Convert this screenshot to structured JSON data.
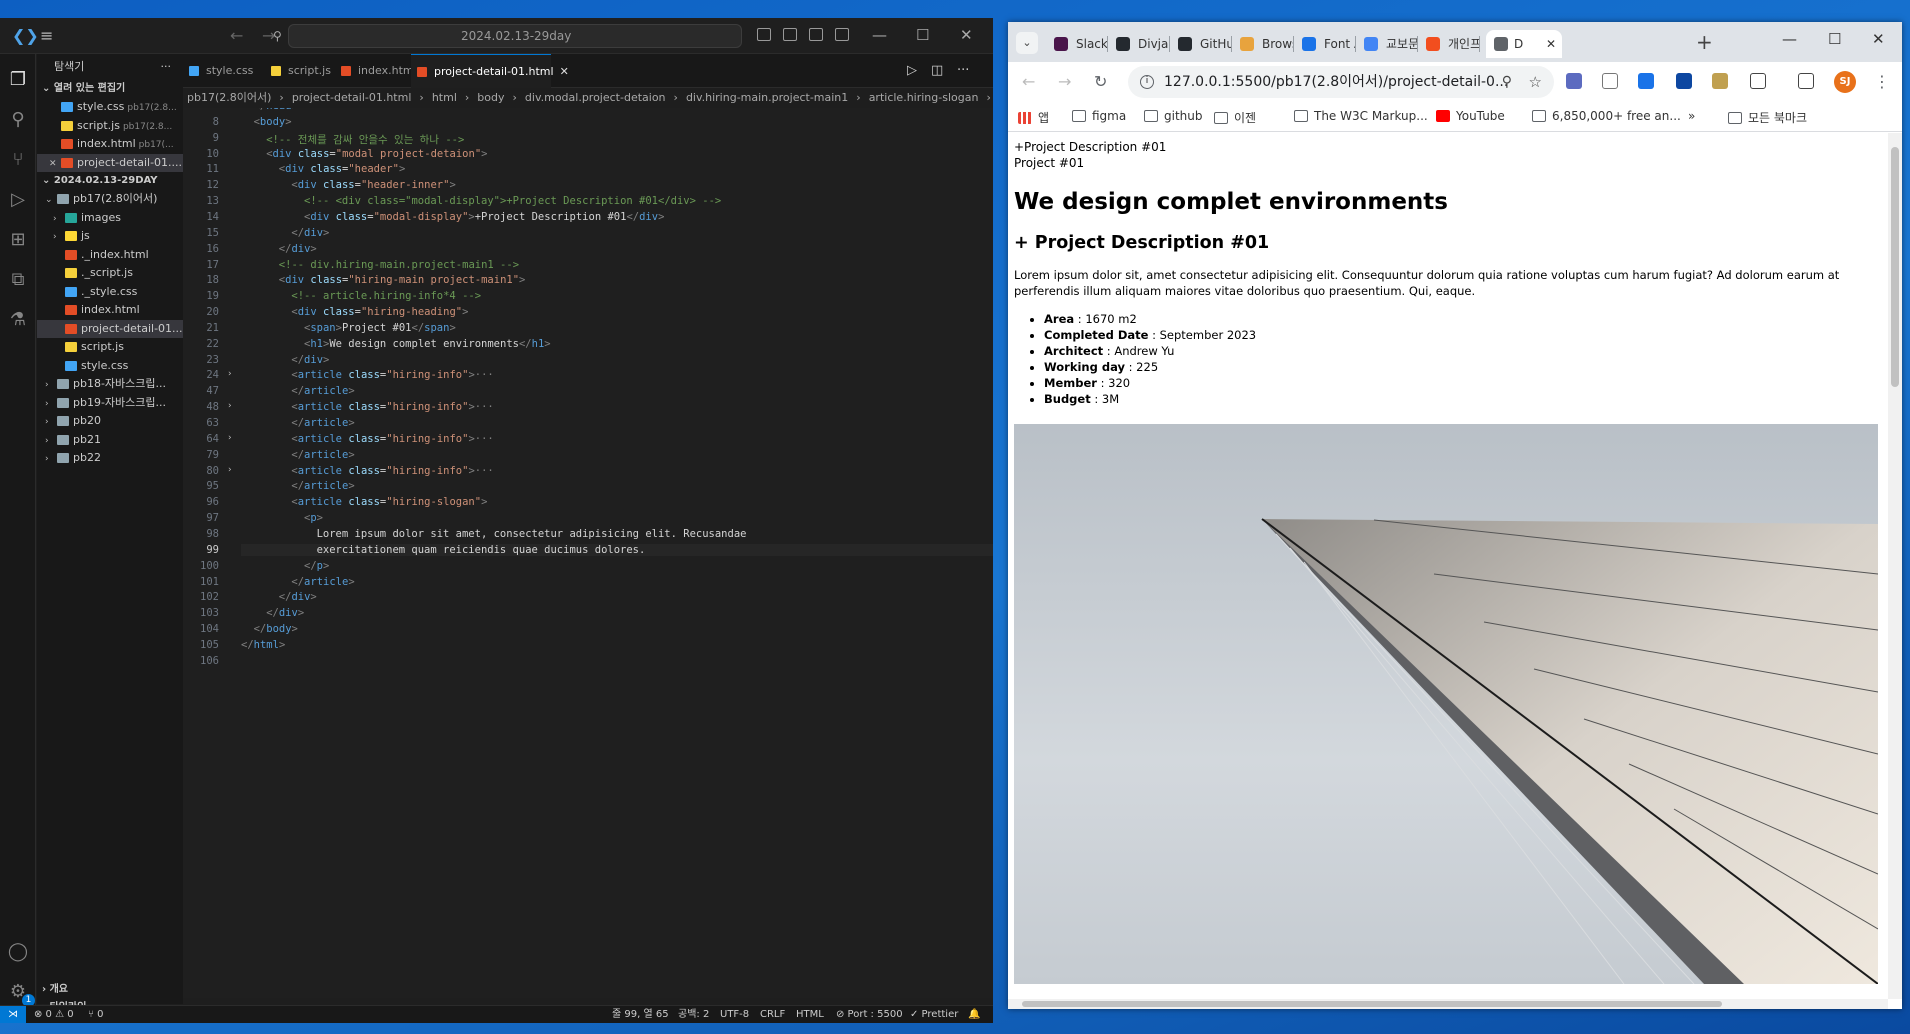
{
  "vscode": {
    "search_text": "2024.02.13-29day",
    "sidebar": {
      "title": "탐색기",
      "more": "···",
      "open_editors_label": "열려 있는 편집기",
      "open_editors": [
        {
          "name": "style.css",
          "desc": "pb17(2.8..."
        },
        {
          "name": "script.js",
          "desc": "pb17(2.8..."
        },
        {
          "name": "index.html",
          "desc": "pb17(..."
        },
        {
          "name": "project-detail-01....",
          "desc": ""
        }
      ],
      "workspace_label": "2024.02.13-29DAY",
      "tree": [
        {
          "name": "pb17(2.8이어서)",
          "kind": "folder-open",
          "depth": 1
        },
        {
          "name": "images",
          "kind": "folder-img",
          "depth": 2
        },
        {
          "name": "js",
          "kind": "folder-js",
          "depth": 2
        },
        {
          "name": "._index.html",
          "kind": "html",
          "depth": 2
        },
        {
          "name": "._script.js",
          "kind": "js",
          "depth": 2
        },
        {
          "name": "._style.css",
          "kind": "css",
          "depth": 2
        },
        {
          "name": "index.html",
          "kind": "html",
          "depth": 2
        },
        {
          "name": "project-detail-01....",
          "kind": "html",
          "depth": 2
        },
        {
          "name": "script.js",
          "kind": "js",
          "depth": 2
        },
        {
          "name": "style.css",
          "kind": "css",
          "depth": 2
        },
        {
          "name": "pb18-자바스크립...",
          "kind": "folder",
          "depth": 1
        },
        {
          "name": "pb19-자바스크립...",
          "kind": "folder",
          "depth": 1
        },
        {
          "name": "pb20",
          "kind": "folder",
          "depth": 1
        },
        {
          "name": "pb21",
          "kind": "folder",
          "depth": 1
        },
        {
          "name": "pb22",
          "kind": "folder",
          "depth": 1
        }
      ],
      "outline_label": "개요",
      "timeline_label": "타임라인"
    },
    "tabs": [
      {
        "label": "style.css",
        "kind": "css"
      },
      {
        "label": "script.js",
        "kind": "js"
      },
      {
        "label": "index.html",
        "kind": "html"
      },
      {
        "label": "project-detail-01.html",
        "kind": "html",
        "active": true
      }
    ],
    "breadcrumbs": [
      "pb17(2.8이어서)",
      "›",
      "project-detail-01.html",
      "›",
      "html",
      "›",
      "body",
      "›",
      "div.modal.project-detaion",
      "›",
      "div.hiring-main.project-main1",
      "›",
      "article.hiring-slogan",
      "›",
      "p"
    ],
    "code_lines": [
      {
        "n": "",
        "html": "<span class=\"br\">&lt;/</span><span class=\"tg\">head</span><span class=\"br\">&gt;</span>",
        "indent": 1
      },
      {
        "n": "8",
        "html": "<span class=\"br\">&lt;</span><span class=\"tg\">body</span><span class=\"br\">&gt;</span>",
        "indent": 1
      },
      {
        "n": "9",
        "html": "<span class=\"cm\">&lt;!-- 전체를 감싸 안을수 있는 하나 --&gt;</span>",
        "indent": 2
      },
      {
        "n": "10",
        "html": "<span class=\"br\">&lt;</span><span class=\"tg\">div</span> <span class=\"at\">class</span>=<span class=\"sv\">\"modal project-detaion\"</span><span class=\"br\">&gt;</span>",
        "indent": 2
      },
      {
        "n": "11",
        "html": "<span class=\"br\">&lt;</span><span class=\"tg\">div</span> <span class=\"at\">class</span>=<span class=\"sv\">\"header\"</span><span class=\"br\">&gt;</span>",
        "indent": 3
      },
      {
        "n": "12",
        "html": "<span class=\"br\">&lt;</span><span class=\"tg\">div</span> <span class=\"at\">class</span>=<span class=\"sv\">\"header-inner\"</span><span class=\"br\">&gt;</span>",
        "indent": 4
      },
      {
        "n": "13",
        "html": "<span class=\"cm\">&lt;!-- &lt;div class=\"modal-display\"&gt;+Project Description #01&lt;/div&gt; --&gt;</span>",
        "indent": 5
      },
      {
        "n": "14",
        "html": "<span class=\"br\">&lt;</span><span class=\"tg\">div</span> <span class=\"at\">class</span>=<span class=\"sv\">\"modal-display\"</span><span class=\"br\">&gt;</span><span class=\"tx\">+Project Description #01</span><span class=\"br\">&lt;/</span><span class=\"tg\">div</span><span class=\"br\">&gt;</span>",
        "indent": 5
      },
      {
        "n": "15",
        "html": "<span class=\"br\">&lt;/</span><span class=\"tg\">div</span><span class=\"br\">&gt;</span>",
        "indent": 4
      },
      {
        "n": "16",
        "html": "<span class=\"br\">&lt;/</span><span class=\"tg\">div</span><span class=\"br\">&gt;</span>",
        "indent": 3
      },
      {
        "n": "17",
        "html": "<span class=\"cm\">&lt;!-- div.hiring-main.project-main1 --&gt;</span>",
        "indent": 3
      },
      {
        "n": "18",
        "html": "<span class=\"br\">&lt;</span><span class=\"tg\">div</span> <span class=\"at\">class</span>=<span class=\"sv\">\"hiring-main project-main1\"</span><span class=\"br\">&gt;</span>",
        "indent": 3
      },
      {
        "n": "19",
        "html": "<span class=\"cm\">&lt;!-- article.hiring-info*4 --&gt;</span>",
        "indent": 4
      },
      {
        "n": "20",
        "html": "<span class=\"br\">&lt;</span><span class=\"tg\">div</span> <span class=\"at\">class</span>=<span class=\"sv\">\"hiring-heading\"</span><span class=\"br\">&gt;</span>",
        "indent": 4
      },
      {
        "n": "21",
        "html": "<span class=\"br\">&lt;</span><span class=\"tg\">span</span><span class=\"br\">&gt;</span><span class=\"tx\">Project #01</span><span class=\"br\">&lt;/</span><span class=\"tg\">span</span><span class=\"br\">&gt;</span>",
        "indent": 5
      },
      {
        "n": "22",
        "html": "<span class=\"br\">&lt;</span><span class=\"tg\">h1</span><span class=\"br\">&gt;</span><span class=\"tx\">We design complet environments</span><span class=\"br\">&lt;/</span><span class=\"tg\">h1</span><span class=\"br\">&gt;</span>",
        "indent": 5
      },
      {
        "n": "23",
        "html": "<span class=\"br\">&lt;/</span><span class=\"tg\">div</span><span class=\"br\">&gt;</span>",
        "indent": 4
      },
      {
        "n": "24",
        "html": "<span class=\"br\">&lt;</span><span class=\"tg\">article</span> <span class=\"at\">class</span>=<span class=\"sv\">\"hiring-info\"</span><span class=\"br\">&gt;</span><span class=\"br\">···</span>",
        "indent": 4,
        "fold": true
      },
      {
        "n": "47",
        "html": "<span class=\"br\">&lt;/</span><span class=\"tg\">article</span><span class=\"br\">&gt;</span>",
        "indent": 4
      },
      {
        "n": "48",
        "html": "<span class=\"br\">&lt;</span><span class=\"tg\">article</span> <span class=\"at\">class</span>=<span class=\"sv\">\"hiring-info\"</span><span class=\"br\">&gt;</span><span class=\"br\">···</span>",
        "indent": 4,
        "fold": true
      },
      {
        "n": "63",
        "html": "<span class=\"br\">&lt;/</span><span class=\"tg\">article</span><span class=\"br\">&gt;</span>",
        "indent": 4
      },
      {
        "n": "64",
        "html": "<span class=\"br\">&lt;</span><span class=\"tg\">article</span> <span class=\"at\">class</span>=<span class=\"sv\">\"hiring-info\"</span><span class=\"br\">&gt;</span><span class=\"br\">···</span>",
        "indent": 4,
        "fold": true
      },
      {
        "n": "79",
        "html": "<span class=\"br\">&lt;/</span><span class=\"tg\">article</span><span class=\"br\">&gt;</span>",
        "indent": 4
      },
      {
        "n": "80",
        "html": "<span class=\"br\">&lt;</span><span class=\"tg\">article</span> <span class=\"at\">class</span>=<span class=\"sv\">\"hiring-info\"</span><span class=\"br\">&gt;</span><span class=\"br\">···</span>",
        "indent": 4,
        "fold": true
      },
      {
        "n": "95",
        "html": "<span class=\"br\">&lt;/</span><span class=\"tg\">article</span><span class=\"br\">&gt;</span>",
        "indent": 4
      },
      {
        "n": "96",
        "html": "<span class=\"br\">&lt;</span><span class=\"tg\">article</span> <span class=\"at\">class</span>=<span class=\"sv\">\"hiring-slogan\"</span><span class=\"br\">&gt;</span>",
        "indent": 4
      },
      {
        "n": "97",
        "html": "<span class=\"br\">&lt;</span><span class=\"tg\">p</span><span class=\"br\">&gt;</span>",
        "indent": 5
      },
      {
        "n": "98",
        "html": "<span class=\"tx\">Lorem ipsum dolor sit amet, consectetur adipisicing elit. Recusandae</span>",
        "indent": 6
      },
      {
        "n": "99",
        "html": "<span class=\"tx\">exercitationem quam reiciendis quae ducimus dolores.</span>",
        "indent": 6,
        "current": true
      },
      {
        "n": "100",
        "html": "<span class=\"br\">&lt;/</span><span class=\"tg\">p</span><span class=\"br\">&gt;</span>",
        "indent": 5
      },
      {
        "n": "101",
        "html": "<span class=\"br\">&lt;/</span><span class=\"tg\">article</span><span class=\"br\">&gt;</span>",
        "indent": 4
      },
      {
        "n": "102",
        "html": "<span class=\"br\">&lt;/</span><span class=\"tg\">div</span><span class=\"br\">&gt;</span>",
        "indent": 3
      },
      {
        "n": "103",
        "html": "<span class=\"br\">&lt;/</span><span class=\"tg\">div</span><span class=\"br\">&gt;</span>",
        "indent": 2
      },
      {
        "n": "104",
        "html": "<span class=\"br\">&lt;/</span><span class=\"tg\">body</span><span class=\"br\">&gt;</span>",
        "indent": 1
      },
      {
        "n": "105",
        "html": "<span class=\"br\">&lt;/</span><span class=\"tg\">html</span><span class=\"br\">&gt;</span>",
        "indent": 0
      },
      {
        "n": "106",
        "html": "",
        "indent": 0
      }
    ],
    "status": {
      "problems": "⊗ 0 ⚠ 0",
      "ports": "⑂ 0",
      "position": "줄 99, 열 65",
      "spaces": "공백: 2",
      "encoding": "UTF-8",
      "eol": "CRLF",
      "language": "HTML",
      "port": "⊘ Port : 5500",
      "prettier": "✓ Prettier",
      "bell": "🔔"
    }
  },
  "chrome": {
    "tabs": [
      {
        "label": "Slack",
        "color": "#4a154b"
      },
      {
        "label": "Divjas",
        "color": "#24292f"
      },
      {
        "label": "GitHu",
        "color": "#24292f"
      },
      {
        "label": "Brows",
        "color": "#e8a33d"
      },
      {
        "label": "Font A",
        "color": "#1a73e8"
      },
      {
        "label": "교보문",
        "color": "#4285f4"
      },
      {
        "label": "개인프",
        "color": "#f24e1e"
      },
      {
        "label": "D",
        "color": "#5f6368",
        "active": true
      }
    ],
    "url": "127.0.0.1:5500/pb17(2.8이어서)/project-detail-0...",
    "avatar": "SJ",
    "bookmarks": [
      "앱",
      "figma",
      "github",
      "이젠",
      "The W3C Markup...",
      "YouTube",
      "6,850,000+ free an...",
      "»",
      "모든 북마크"
    ],
    "page": {
      "modal_display": "+Project Description #01",
      "project_label": "Project #01",
      "h1": "We design complet environments",
      "h2": "+ Project Description #01",
      "paragraph": "Lorem ipsum dolor sit, amet consectetur adipisicing elit. Consequuntur dolorum quia ratione voluptas cum harum fugiat? Ad dolorum earum at perferendis illum aliquam maiores vitae doloribus quo praesentium. Qui, eaque.",
      "details": [
        {
          "label": "Area",
          "value": " : 1670 m2"
        },
        {
          "label": "Completed Date",
          "value": " : September 2023"
        },
        {
          "label": "Architect",
          "value": " : Andrew Yu"
        },
        {
          "label": "Working day",
          "value": " : 225"
        },
        {
          "label": "Member",
          "value": " : 320"
        },
        {
          "label": "Budget",
          "value": " : 3M"
        }
      ]
    }
  }
}
